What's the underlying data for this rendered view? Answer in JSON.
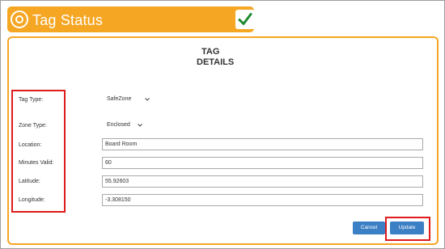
{
  "header": {
    "title": "Tag Status",
    "logo_icon": "target-ring-icon",
    "check_icon": "green-check-icon",
    "accent_color": "#f5a623",
    "check_color": "#1e8a2e"
  },
  "panel": {
    "title_line1": "TAG",
    "title_line2": "DETAILS"
  },
  "form": {
    "tag_type": {
      "label": "Tag Type:",
      "value": "SafeZone"
    },
    "zone_type": {
      "label": "Zone Type:",
      "value": "Enclosed"
    },
    "location": {
      "label": "Location:",
      "value": "Board Room"
    },
    "minutes_valid": {
      "label": "Minutes Valid:",
      "value": "60"
    },
    "latitude": {
      "label": "Latitude:",
      "value": "55.92603"
    },
    "longitude": {
      "label": "Longitude:",
      "value": "-3.308150"
    }
  },
  "buttons": {
    "cancel_label": "Cancel",
    "update_label": "Update",
    "button_color": "#3b7fc4"
  },
  "highlight_color": "#e01b1b"
}
